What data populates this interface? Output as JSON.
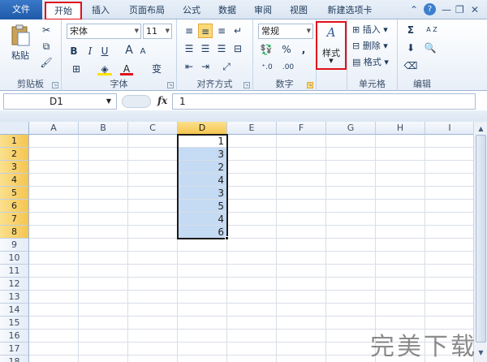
{
  "tabs": [
    {
      "label": "文件"
    },
    {
      "label": "开始"
    },
    {
      "label": "插入"
    },
    {
      "label": "页面布局"
    },
    {
      "label": "公式"
    },
    {
      "label": "数据"
    },
    {
      "label": "审阅"
    },
    {
      "label": "视图"
    },
    {
      "label": "新建选项卡"
    }
  ],
  "window_controls": {
    "collapse": "⌃",
    "help": "?",
    "minimize": "—",
    "restore": "❐",
    "close": "✕"
  },
  "ribbon": {
    "clipboard": {
      "label": "剪贴板",
      "paste": "粘贴"
    },
    "font": {
      "label": "字体",
      "name": "宋体",
      "size": "11",
      "bold": "B",
      "italic": "I",
      "underline": "U",
      "grow": "A",
      "shrink": "A",
      "fontcolor": "A",
      "wen": "变"
    },
    "alignment": {
      "label": "对齐方式"
    },
    "number": {
      "label": "数字",
      "format": "常规",
      "percent": "%",
      "comma": ",",
      "dec_inc": "⁺.0",
      "dec_dec": ".00"
    },
    "styles": {
      "label": "样式"
    },
    "cells": {
      "label": "单元格",
      "insert": "插入",
      "delete": "删除",
      "format": "格式"
    },
    "editing": {
      "label": "编辑",
      "sum": "Σ",
      "sort": "A Z"
    }
  },
  "formula": {
    "name_box": "D1",
    "fx": "fx",
    "content": "1"
  },
  "columns": [
    "A",
    "B",
    "C",
    "D",
    "E",
    "F",
    "G",
    "H",
    "I"
  ],
  "rows": [
    "1",
    "2",
    "3",
    "4",
    "5",
    "6",
    "7",
    "8",
    "9",
    "10",
    "11",
    "12",
    "13",
    "14",
    "15",
    "16",
    "17",
    "18"
  ],
  "selected_column": "D",
  "cells_D": [
    "1",
    "3",
    "2",
    "4",
    "3",
    "5",
    "4",
    "6"
  ],
  "watermark": "完美下载",
  "colors": {
    "accent": "#1f5aa8",
    "highlight": "#e0111b",
    "selection": "#c5daf3"
  }
}
